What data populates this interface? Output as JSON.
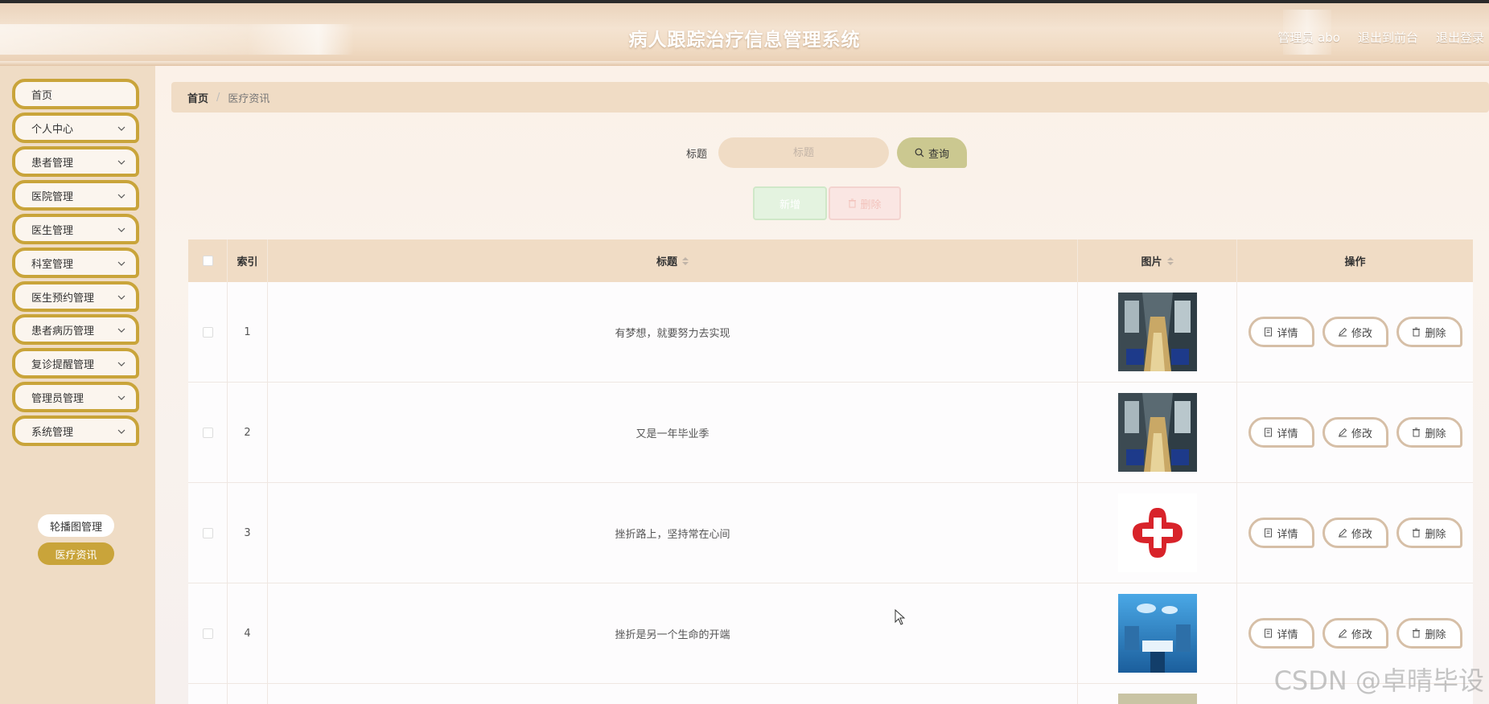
{
  "header": {
    "title": "病人跟踪治疗信息管理系统",
    "links": [
      "管理员 abo",
      "退出到前台",
      "退出登录"
    ]
  },
  "sidebar": {
    "items": [
      {
        "label": "首页",
        "has_children": false
      },
      {
        "label": "个人中心",
        "has_children": true
      },
      {
        "label": "患者管理",
        "has_children": true
      },
      {
        "label": "医院管理",
        "has_children": true
      },
      {
        "label": "医生管理",
        "has_children": true
      },
      {
        "label": "科室管理",
        "has_children": true
      },
      {
        "label": "医生预约管理",
        "has_children": true
      },
      {
        "label": "患者病历管理",
        "has_children": true
      },
      {
        "label": "复诊提醒管理",
        "has_children": true
      },
      {
        "label": "管理员管理",
        "has_children": true
      },
      {
        "label": "系统管理",
        "has_children": true
      }
    ],
    "subitems": [
      {
        "label": "轮播图管理",
        "active": false
      },
      {
        "label": "医疗资讯",
        "active": true
      }
    ]
  },
  "breadcrumb": {
    "home": "首页",
    "separator": "/",
    "current": "医疗资讯"
  },
  "search": {
    "label": "标题",
    "placeholder": "标题",
    "button": "查询"
  },
  "actions": {
    "add": "新增",
    "delete": "删除"
  },
  "table": {
    "headers": {
      "index": "索引",
      "title": "标题",
      "image": "图片",
      "ops": "操作"
    },
    "rows": [
      {
        "index": "1",
        "title": "有梦想，就要努力去实现",
        "image": "hospital-ward-photo"
      },
      {
        "index": "2",
        "title": "又是一年毕业季",
        "image": "hospital-ward-photo"
      },
      {
        "index": "3",
        "title": "挫折路上，坚持常在心间",
        "image": "red-cross-logo"
      },
      {
        "index": "4",
        "title": "挫折是另一个生命的开端",
        "image": "operating-room-photo"
      }
    ],
    "op_labels": {
      "detail": "详情",
      "edit": "修改",
      "delete": "删除"
    }
  },
  "watermark": "CSDN @卓晴毕设",
  "colors": {
    "accent": "#c9a43a",
    "header": "#f0dcc5",
    "search_button": "#cbc890"
  }
}
